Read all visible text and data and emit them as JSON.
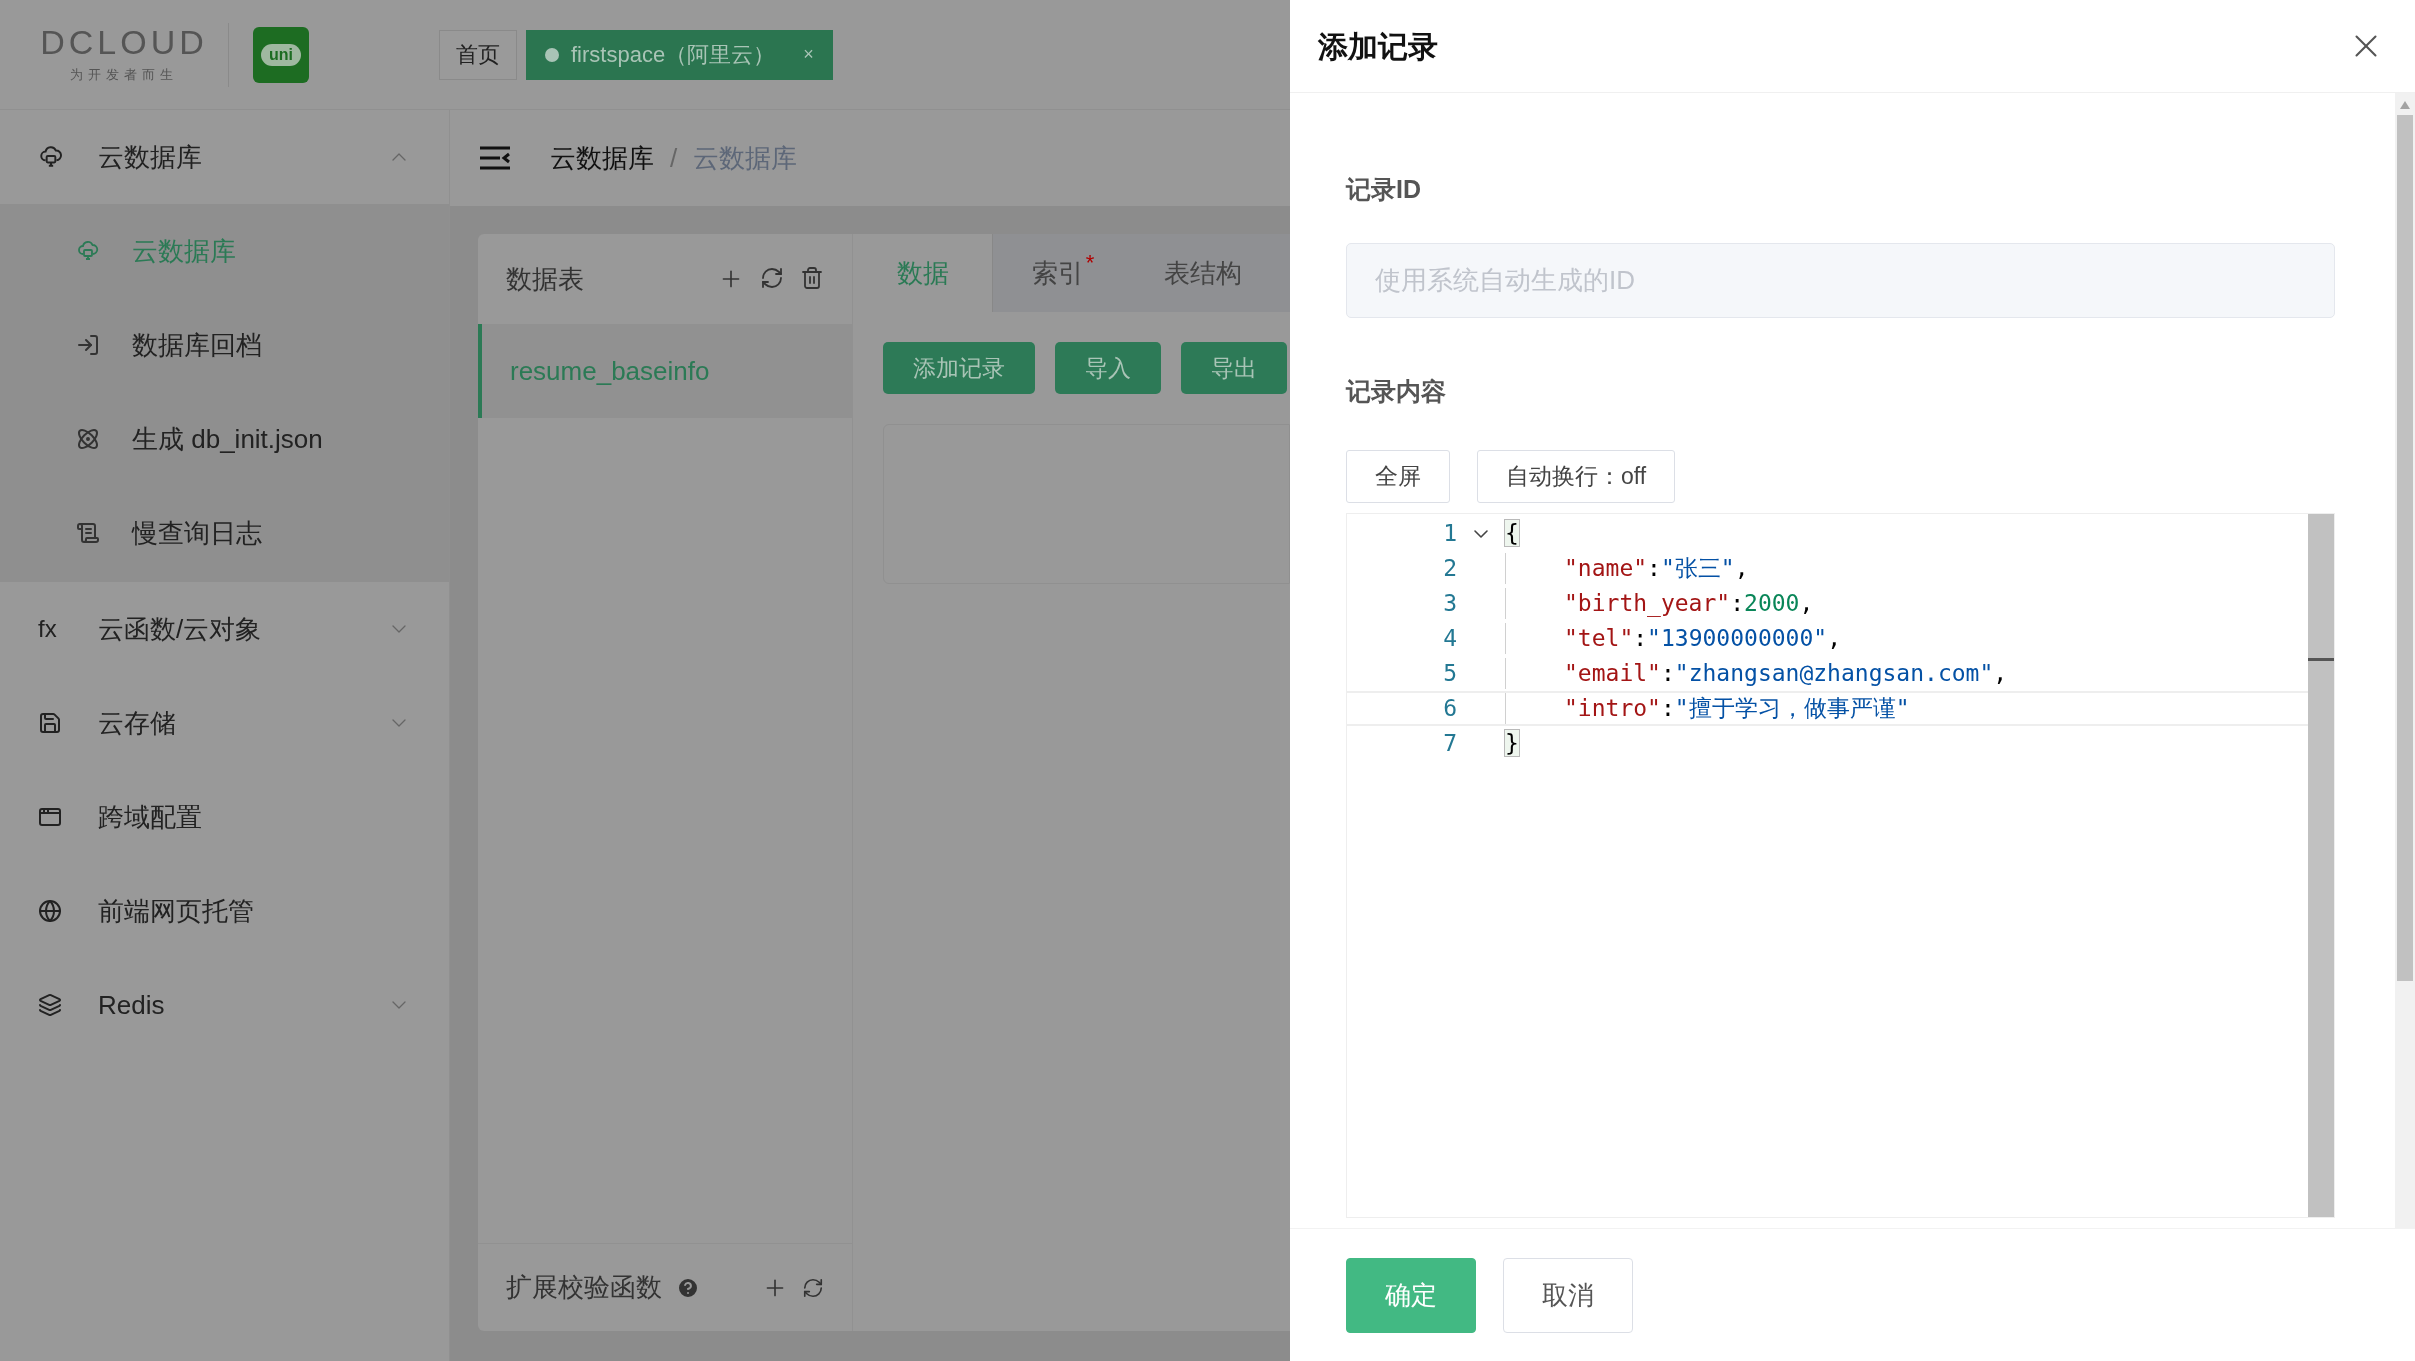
{
  "header": {
    "logo_text": "DCLOUD",
    "logo_tagline": "为开发者而生",
    "app_icon_text": "uni",
    "tabs": [
      {
        "label": "首页",
        "selected": false
      },
      {
        "label": "firstspace（阿里云）",
        "selected": true,
        "close": "×"
      }
    ]
  },
  "sidebar": {
    "items": [
      {
        "label": "云数据库",
        "kind": "group",
        "expanded": true,
        "children": [
          {
            "label": "云数据库",
            "selected": true
          },
          {
            "label": "数据库回档",
            "selected": false
          },
          {
            "label": "生成 db_init.json",
            "selected": false
          },
          {
            "label": "慢查询日志",
            "selected": false
          }
        ]
      },
      {
        "label": "云函数/云对象",
        "kind": "group",
        "expanded": false,
        "icon_text": "fx"
      },
      {
        "label": "云存储",
        "kind": "group",
        "expanded": false
      },
      {
        "label": "跨域配置",
        "kind": "link"
      },
      {
        "label": "前端网页托管",
        "kind": "link"
      },
      {
        "label": "Redis",
        "kind": "group",
        "expanded": false
      }
    ]
  },
  "breadcrumb": {
    "separator": "/",
    "items": [
      {
        "label": "云数据库",
        "current": false
      },
      {
        "label": "云数据库",
        "current": true
      }
    ]
  },
  "collections": {
    "title": "数据表",
    "items": [
      {
        "label": "resume_baseinfo",
        "selected": true
      }
    ],
    "footer": {
      "label": "扩展校验函数"
    }
  },
  "tabs": [
    {
      "label": "数据",
      "selected": true
    },
    {
      "label": "索引",
      "selected": false,
      "marker": "*"
    },
    {
      "label": "表结构",
      "selected": false
    }
  ],
  "toolbar": [
    "添加记录",
    "导入",
    "导出"
  ],
  "drawer": {
    "title": "添加记录",
    "id_field": {
      "label": "记录ID",
      "placeholder": "使用系统自动生成的ID"
    },
    "content_label": "记录内容",
    "editor_buttons": [
      "全屏",
      "自动换行：off"
    ],
    "editor": {
      "lines": [
        {
          "number": "1",
          "foldable": true,
          "active": false,
          "indented": false,
          "tokens": [
            {
              "kind": "bracket",
              "text": "{"
            }
          ]
        },
        {
          "number": "2",
          "foldable": false,
          "active": false,
          "indented": true,
          "tokens": [
            {
              "kind": "key",
              "text": "\"name\""
            },
            {
              "kind": "punct",
              "text": ":"
            },
            {
              "kind": "string",
              "text": "\"张三\""
            },
            {
              "kind": "punct",
              "text": ","
            }
          ]
        },
        {
          "number": "3",
          "foldable": false,
          "active": false,
          "indented": true,
          "tokens": [
            {
              "kind": "key",
              "text": "\"birth_year\""
            },
            {
              "kind": "punct",
              "text": ":"
            },
            {
              "kind": "number",
              "text": "2000"
            },
            {
              "kind": "punct",
              "text": ","
            }
          ]
        },
        {
          "number": "4",
          "foldable": false,
          "active": false,
          "indented": true,
          "tokens": [
            {
              "kind": "key",
              "text": "\"tel\""
            },
            {
              "kind": "punct",
              "text": ":"
            },
            {
              "kind": "string",
              "text": "\"13900000000\""
            },
            {
              "kind": "punct",
              "text": ","
            }
          ]
        },
        {
          "number": "5",
          "foldable": false,
          "active": false,
          "indented": true,
          "tokens": [
            {
              "kind": "key",
              "text": "\"email\""
            },
            {
              "kind": "punct",
              "text": ":"
            },
            {
              "kind": "string",
              "text": "\"zhangsan@zhangsan.com\""
            },
            {
              "kind": "punct",
              "text": ","
            }
          ]
        },
        {
          "number": "6",
          "foldable": false,
          "active": true,
          "indented": true,
          "tokens": [
            {
              "kind": "key",
              "text": "\"intro\""
            },
            {
              "kind": "punct",
              "text": ":"
            },
            {
              "kind": "string",
              "text": "\"擅于学习，做事严谨\""
            }
          ]
        },
        {
          "number": "7",
          "foldable": false,
          "active": false,
          "indented": false,
          "tokens": [
            {
              "kind": "bracket",
              "text": "}"
            }
          ]
        }
      ]
    },
    "footer_buttons": [
      {
        "label": "确定",
        "kind": "primary"
      },
      {
        "label": "取消",
        "kind": "default"
      }
    ]
  }
}
